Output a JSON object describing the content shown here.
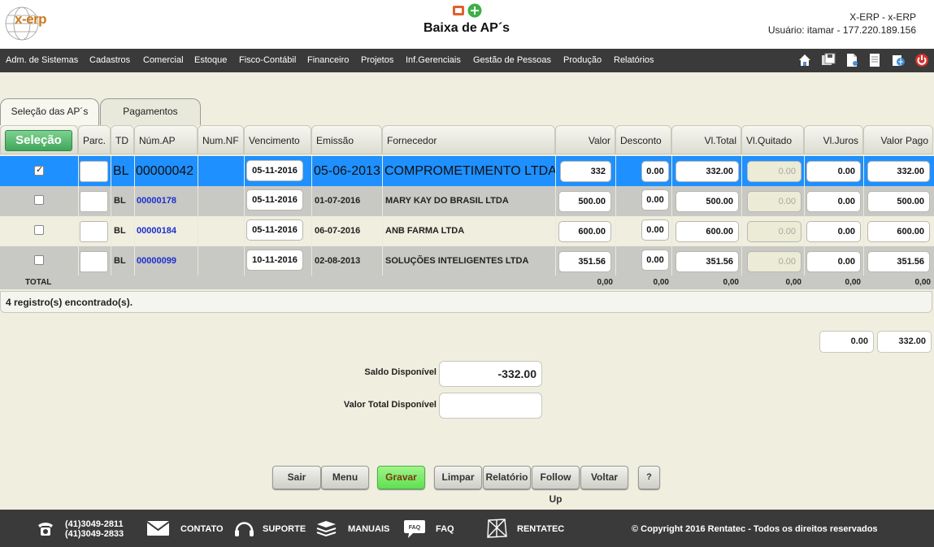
{
  "header": {
    "logo_text": "x-erp",
    "title": "Baixa de AP´s",
    "system_name": "X-ERP - x-ERP",
    "user_info": "Usuário: itamar - 177.220.189.156"
  },
  "menu": {
    "items": [
      "Adm. de Sistemas",
      "Cadastros",
      "Comercial",
      "Estoque",
      "Fisco-Contábil",
      "Financeiro",
      "Projetos",
      "Inf.Gerenciais",
      "Gestão de Pessoas",
      "Produção",
      "Relatórios"
    ],
    "toolbar_icons": [
      "home-icon",
      "save-icon",
      "document-icon",
      "notes-icon",
      "globe-icon",
      "power-icon"
    ]
  },
  "tabs": [
    {
      "label": "Seleção das AP´s",
      "active": true
    },
    {
      "label": "Pagamentos",
      "active": false
    }
  ],
  "table": {
    "select_button": "Seleção",
    "headers": [
      "Parc.",
      "TD",
      "Núm.AP",
      "Num.NF",
      "Vencimento",
      "Emissão",
      "Fornecedor",
      "Valor",
      "Desconto",
      "Vl.Total",
      "Vl.Quitado",
      "Vl.Juros",
      "Valor Pago"
    ],
    "rows": [
      {
        "checked": true,
        "parc": "",
        "td": "BL",
        "num_ap": "00000042",
        "num_nf": "",
        "vencimento": "05-11-2016",
        "emissao": "05-06-2013",
        "fornecedor": "COMPROMETIMENTO LTDA",
        "valor": "332",
        "desconto": "0.00",
        "vl_total": "332.00",
        "vl_quitado": "0.00",
        "vl_juros": "0.00",
        "valor_pago": "332.00"
      },
      {
        "checked": false,
        "parc": "",
        "td": "BL",
        "num_ap": "00000178",
        "num_nf": "",
        "vencimento": "05-11-2016",
        "emissao": "01-07-2016",
        "fornecedor": "MARY KAY DO BRASIL LTDA",
        "valor": "500.00",
        "desconto": "0.00",
        "vl_total": "500.00",
        "vl_quitado": "0.00",
        "vl_juros": "0.00",
        "valor_pago": "500.00"
      },
      {
        "checked": false,
        "parc": "",
        "td": "BL",
        "num_ap": "00000184",
        "num_nf": "",
        "vencimento": "05-11-2016",
        "emissao": "06-07-2016",
        "fornecedor": "ANB FARMA LTDA",
        "valor": "600.00",
        "desconto": "0.00",
        "vl_total": "600.00",
        "vl_quitado": "0.00",
        "vl_juros": "0.00",
        "valor_pago": "600.00"
      },
      {
        "checked": false,
        "parc": "",
        "td": "BL",
        "num_ap": "00000099",
        "num_nf": "",
        "vencimento": "10-11-2016",
        "emissao": "02-08-2013",
        "fornecedor": "SOLUÇÕES INTELIGENTES LTDA",
        "valor": "351.56",
        "desconto": "0.00",
        "vl_total": "351.56",
        "vl_quitado": "0.00",
        "vl_juros": "0.00",
        "valor_pago": "351.56"
      }
    ],
    "totals": {
      "label": "TOTAL",
      "valor": "0,00",
      "desconto": "0,00",
      "vl_total": "0,00",
      "vl_quitado": "0,00",
      "vl_juros": "0,00",
      "valor_pago": "0,00"
    },
    "status": "4 registro(s) encontrado(s)."
  },
  "summary": {
    "juros_total": "0.00",
    "pago_total": "332.00",
    "saldo_label": "Saldo Disponível",
    "saldo_value": "-332.00",
    "valor_total_label": "Valor Total Disponível",
    "valor_total_value": ""
  },
  "actions": {
    "sair": "Sair",
    "menu": "Menu",
    "gravar": "Gravar",
    "limpar": "Limpar",
    "relatorio": "Relatório",
    "follow_up": "Follow Up",
    "voltar": "Voltar",
    "help": "?"
  },
  "footer": {
    "phone1": "(41)3049-2811",
    "phone2": "(41)3049-2833",
    "contato": "CONTATO",
    "suporte": "SUPORTE",
    "manuais": "MANUAIS",
    "faq_icon_text": "FAQ",
    "faq": "FAQ",
    "rentatec": "RENTATEC",
    "copyright": "© Copyright 2016 Rentatec - Todos os direitos reservados"
  },
  "colors": {
    "selected_row": "#1e90ff",
    "menu_bg": "#3a3a3a",
    "accent_green": "#3fa65a"
  }
}
